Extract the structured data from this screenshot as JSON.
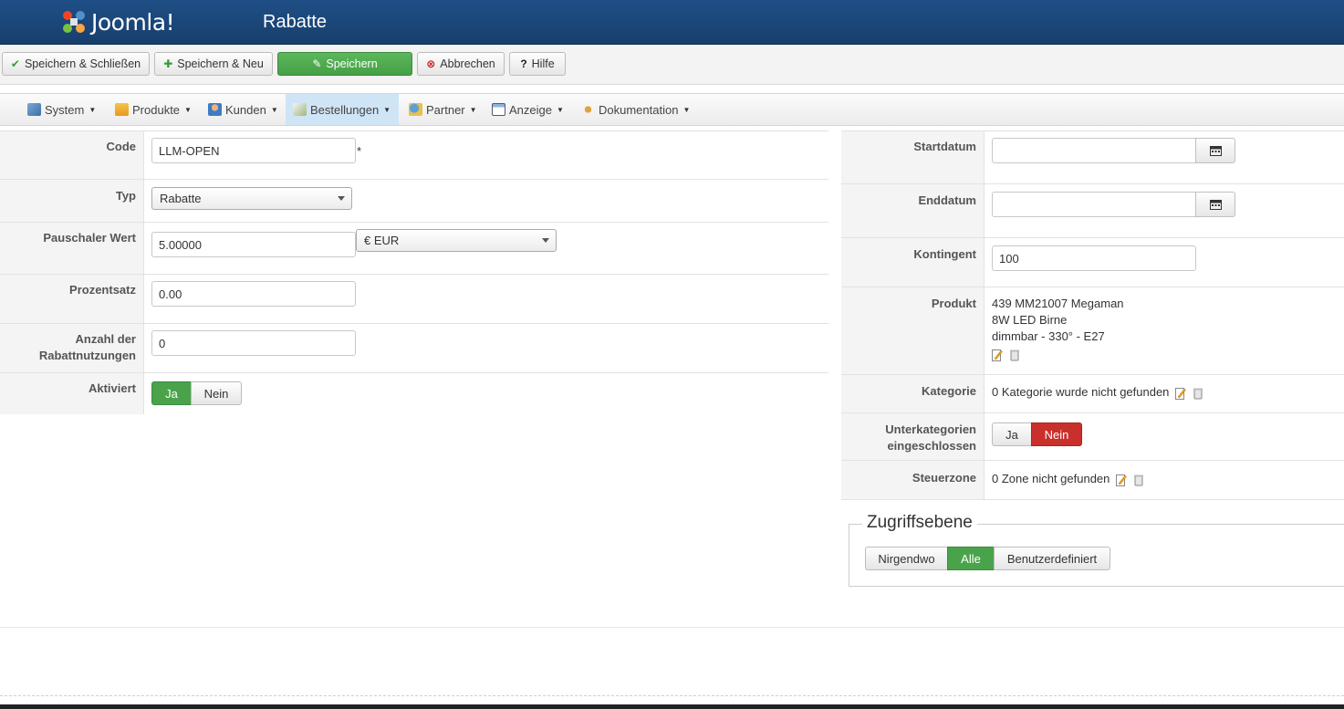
{
  "header": {
    "logo_text": "Joomla!",
    "title": "Rabatte"
  },
  "toolbar": {
    "save_close": "Speichern & Schließen",
    "save_new": "Speichern & Neu",
    "save": "Speichern",
    "cancel": "Abbrechen",
    "help": "Hilfe"
  },
  "menu": {
    "items": [
      "System",
      "Produkte",
      "Kunden",
      "Bestellungen",
      "Partner",
      "Anzeige",
      "Dokumentation"
    ],
    "active": "Bestellungen"
  },
  "form_left": {
    "code_label": "Code",
    "code_value": "LLM-OPEN",
    "required_mark": "*",
    "type_label": "Typ",
    "type_value": "Rabatte",
    "flat_label": "Pauschaler Wert",
    "flat_value": "5.00000",
    "currency_value": "€ EUR",
    "percent_label": "Prozentsatz",
    "percent_value": "0.00",
    "uses_label_1": "Anzahl der",
    "uses_label_2": "Rabattnutzungen",
    "uses_value": "0",
    "active_label": "Aktiviert",
    "active_yes": "Ja",
    "active_no": "Nein",
    "active_selected": "Ja"
  },
  "form_right": {
    "start_label": "Startdatum",
    "start_value": "",
    "end_label": "Enddatum",
    "end_value": "",
    "quota_label": "Kontingent",
    "quota_value": "100",
    "product_label": "Produkt",
    "product_line1": "439 MM21007 Megaman",
    "product_line2": "8W LED Birne",
    "product_line3": "dimmbar - 330° - E27",
    "category_label": "Kategorie",
    "category_value": "0 Kategorie wurde nicht gefunden",
    "subcat_label_1": "Unterkategorien",
    "subcat_label_2": "eingeschlossen",
    "subcat_yes": "Ja",
    "subcat_no": "Nein",
    "subcat_selected": "Nein",
    "taxzone_label": "Steuerzone",
    "taxzone_value": "0 Zone nicht gefunden"
  },
  "access": {
    "legend": "Zugriffsebene",
    "options": [
      "Nirgendwo",
      "Alle",
      "Benutzerdefiniert"
    ],
    "selected": "Alle"
  },
  "colors": {
    "header": "#1f4f86",
    "green": "#4aa34a",
    "red": "#c9302c",
    "active_menu": "#cfe4f5"
  }
}
